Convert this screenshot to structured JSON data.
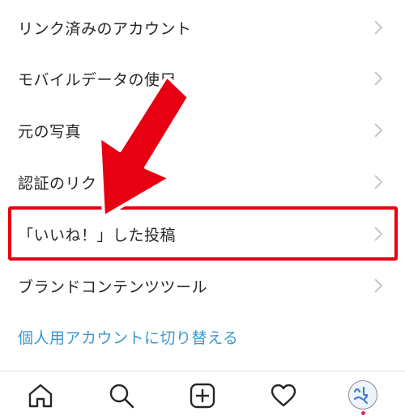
{
  "settings": {
    "items": [
      {
        "label": "リンク済みのアカウント"
      },
      {
        "label": "モバイルデータの使用"
      },
      {
        "label": "元の写真"
      },
      {
        "label": "認証のリク"
      },
      {
        "label": "「いいね！」した投稿"
      },
      {
        "label": "ブランドコンテンツツール"
      }
    ],
    "switch_account": "個人用アカウントに切り替える"
  },
  "colors": {
    "highlight": "#e60012",
    "arrow": "#e60012",
    "link": "#3b97d3"
  },
  "tabbar": {
    "icons": [
      "home-icon",
      "search-icon",
      "add-post-icon",
      "heart-icon",
      "profile-avatar"
    ]
  }
}
